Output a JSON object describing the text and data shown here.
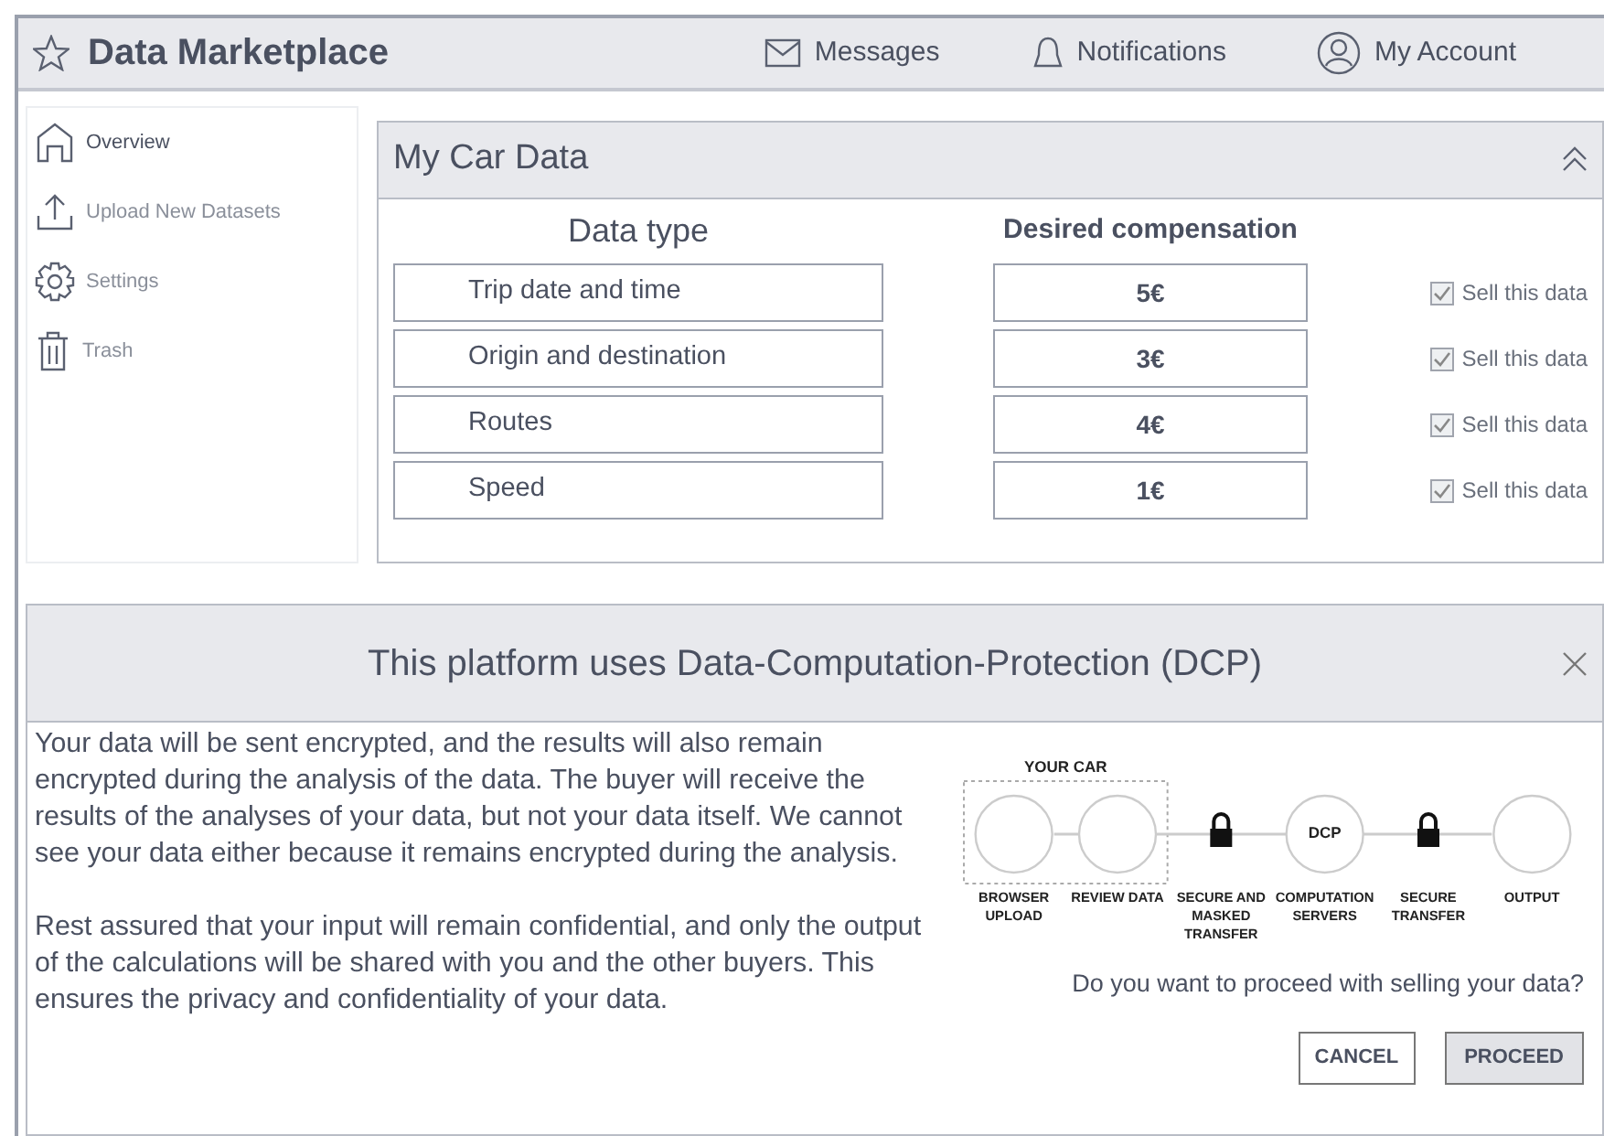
{
  "app": {
    "title": "Data Marketplace"
  },
  "topnav": [
    {
      "kind": "mail",
      "label": "Messages"
    },
    {
      "kind": "bell",
      "label": "Notifications"
    },
    {
      "kind": "user",
      "label": "My Account"
    }
  ],
  "sidebar": {
    "items": [
      {
        "kind": "home",
        "label": "Overview",
        "selected": true
      },
      {
        "kind": "upload",
        "label": "Upload New Datasets",
        "selected": false
      },
      {
        "kind": "gear",
        "label": "Settings",
        "selected": false
      },
      {
        "kind": "trash",
        "label": "Trash",
        "selected": false
      }
    ]
  },
  "panel": {
    "title": "My Car Data",
    "expanded": true,
    "columns": [
      "Data type",
      "Desired compensation"
    ],
    "rows": [
      {
        "data_type": "Trip date and time",
        "compensation": "5€",
        "sell_label": "Sell this data",
        "checked": true
      },
      {
        "data_type": "Origin and destination",
        "compensation": "3€",
        "sell_label": "Sell this data",
        "checked": true
      },
      {
        "data_type": "Routes",
        "compensation": "4€",
        "sell_label": "Sell this data",
        "checked": true
      },
      {
        "data_type": "Speed",
        "compensation": "1€",
        "sell_label": "Sell this data",
        "checked": true
      }
    ]
  },
  "dialog": {
    "title": "This platform uses Data-Computation-Protection (DCP)",
    "paragraphs": [
      "Your data will be sent encrypted, and the results will also remain encrypted during the analysis of the data. The buyer will receive the results of the analyses of your data, but not your data itself. We cannot see your data either because it remains encrypted during the analysis.",
      "Rest assured that your input will remain confidential, and only the output of the calculations will be shared with you and the other buyers. This ensures the privacy and confidentiality of your data."
    ],
    "diagram": {
      "group_label": "YOUR CAR",
      "steps": [
        {
          "kind": "circle",
          "label": "BROWSER UPLOAD"
        },
        {
          "kind": "circle",
          "label": "REVIEW DATA"
        },
        {
          "kind": "lock",
          "label": "SECURE AND MASKED TRANSFER"
        },
        {
          "kind": "circle",
          "node_text": "DCP",
          "label": "COMPUTATION SERVERS"
        },
        {
          "kind": "lock",
          "label": "SECURE TRANSFER"
        },
        {
          "kind": "circle",
          "label": "OUTPUT"
        }
      ]
    },
    "question": "Do you want to proceed with selling your data?",
    "buttons": [
      {
        "kind": "secondary",
        "label": "CANCEL"
      },
      {
        "kind": "primary",
        "label": "PROCEED"
      }
    ]
  }
}
